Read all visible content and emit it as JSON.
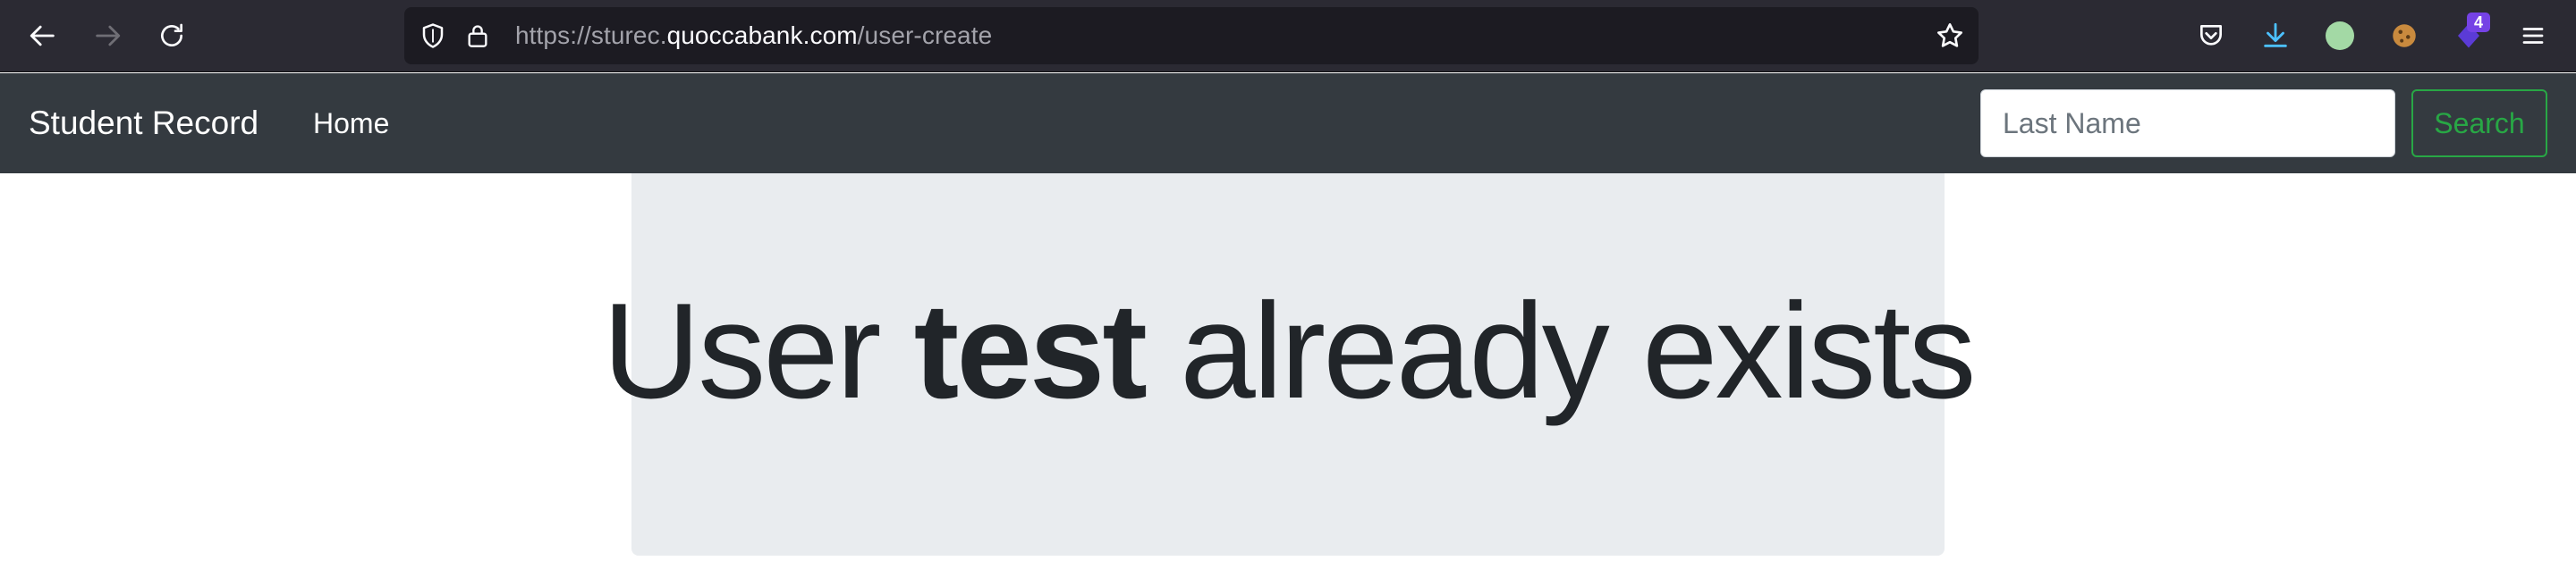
{
  "browser": {
    "url_prefix": "https://sturec.",
    "url_domain": "quoccabank.com",
    "url_path": "/user-create",
    "extension_badge": "4"
  },
  "navbar": {
    "brand": "Student Record",
    "home_link": "Home",
    "search_placeholder": "Last Name",
    "search_button": "Search"
  },
  "message": {
    "prefix": "User ",
    "username": "test",
    "suffix": " already exists"
  },
  "colors": {
    "browser_bg": "#2b2a33",
    "navbar_bg": "#343a40",
    "jumbotron_bg": "#e9ecef",
    "search_accent": "#28a745"
  }
}
